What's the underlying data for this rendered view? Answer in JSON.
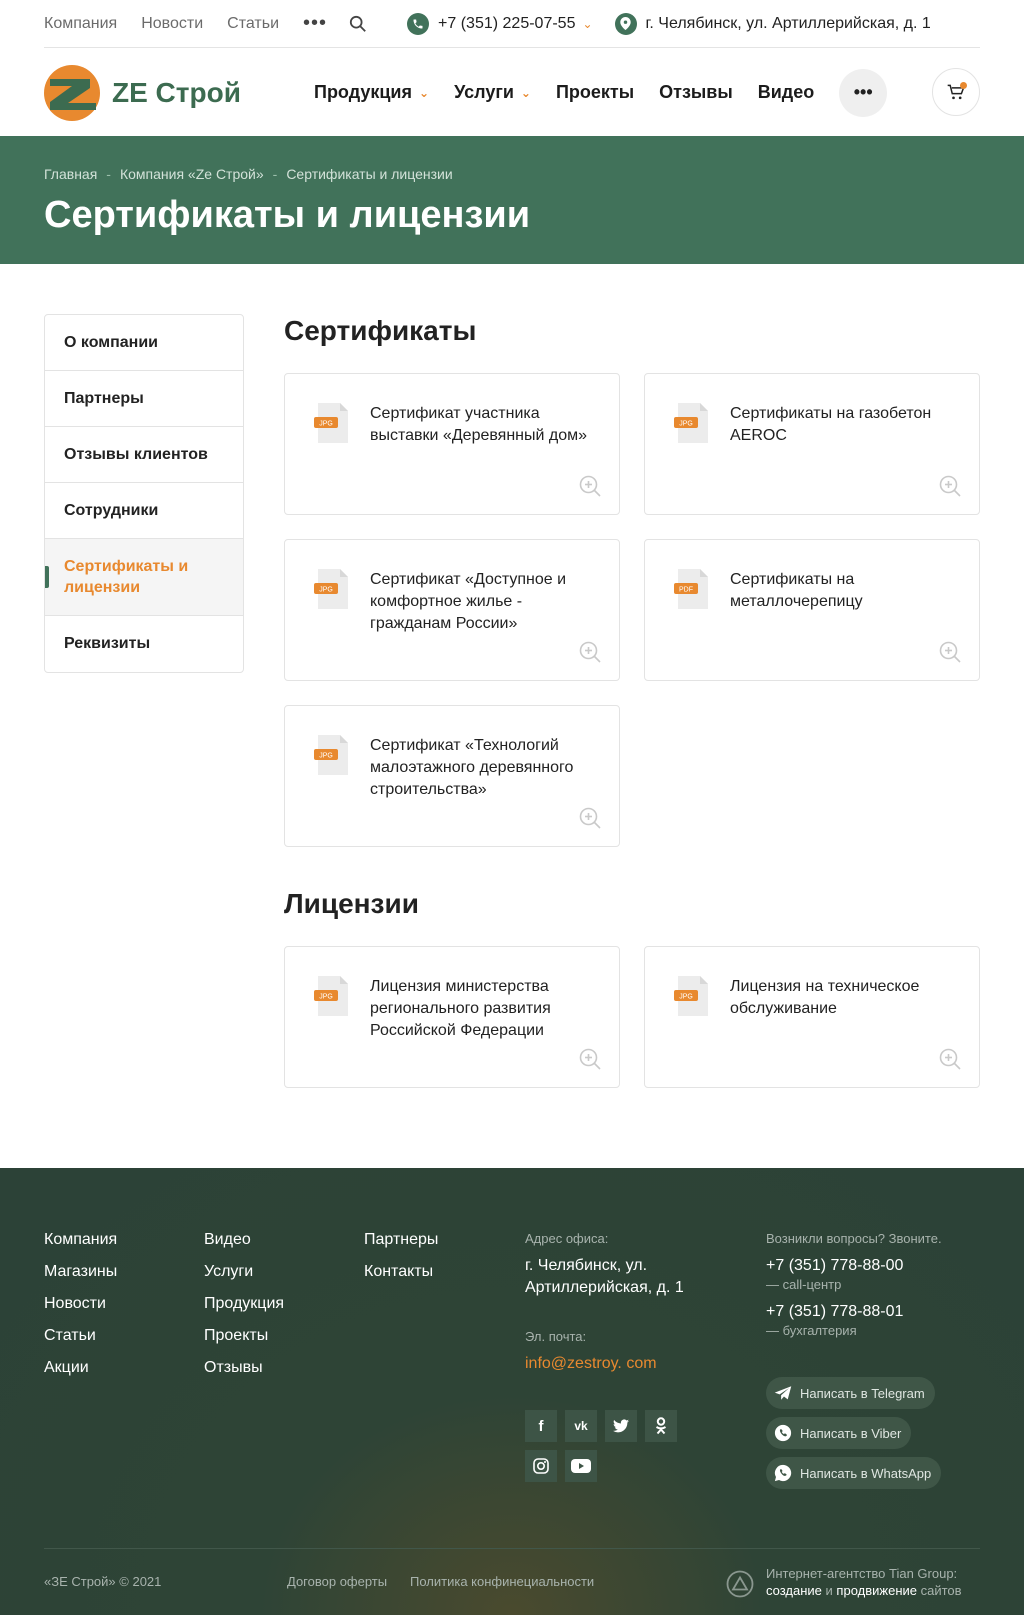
{
  "topbar": {
    "links": [
      "Компания",
      "Новости",
      "Статьи"
    ],
    "more": "•••",
    "phone": "+7 (351) 225-07-55",
    "address": "г. Челябинск, ул. Артиллерийская, д. 1"
  },
  "header": {
    "logo_text": "ZE Строй",
    "nav": [
      "Продукция",
      "Услуги",
      "Проекты",
      "Отзывы",
      "Видео"
    ],
    "more": "•••"
  },
  "breadcrumbs": [
    "Главная",
    "Компания «Ze Строй»",
    "Сертификаты и лицензии"
  ],
  "breadcrumb_sep": "-",
  "page_title": "Сертификаты и лицензии",
  "sidebar": [
    "О компании",
    "Партнеры",
    "Отзывы клиентов",
    "Сотрудники",
    "Сертификаты и лицензии",
    "Реквизиты"
  ],
  "certificates": {
    "title": "Сертификаты",
    "items": [
      {
        "title": "Сертификат участника выставки «Деревянный дом»",
        "type": "JPG"
      },
      {
        "title": "Сертификаты на газобетон AEROC",
        "type": "JPG"
      },
      {
        "title": "Сертификат «Доступное и комфортное жилье - гражданам России»",
        "type": "JPG"
      },
      {
        "title": "Сертификаты на металлочерепицу",
        "type": "PDF"
      },
      {
        "title": "Сертификат «Технологий малоэтажного деревянного строительства»",
        "type": "JPG"
      }
    ]
  },
  "licenses": {
    "title": "Лицензии",
    "items": [
      {
        "title": "Лицензия министерства регионального развития Российской Федерации",
        "type": "JPG"
      },
      {
        "title": "Лицензия на техническое обслуживание",
        "type": "JPG"
      }
    ]
  },
  "footer": {
    "col1": [
      "Компания",
      "Магазины",
      "Новости",
      "Статьи",
      "Акции"
    ],
    "col2": [
      "Видео",
      "Услуги",
      "Продукция",
      "Проекты",
      "Отзывы"
    ],
    "col3": [
      "Партнеры",
      "Контакты"
    ],
    "address_label": "Адрес офиса:",
    "address_line1": "г. Челябинск, ул.",
    "address_line2": "Артиллерийская, д. 1",
    "email_label": "Эл. почта:",
    "email": "info@zestroy. com",
    "questions_label": "Возникли вопросы? Звоните.",
    "phone1": "+7 (351) 778-88-00",
    "phone1_note": "— call-центр",
    "phone2": "+7 (351) 778-88-01",
    "phone2_note": "— бухгалтерия",
    "telegram": "Написать в Telegram",
    "viber": "Написать в Viber",
    "whatsapp": "Написать в WhatsApp",
    "social": [
      "f",
      "vk",
      "twitter",
      "ok",
      "instagram",
      "youtube"
    ],
    "copyright": "«ЗЕ Строй» © 2021",
    "offer": "Договор оферты",
    "privacy": "Политика конфинециальности",
    "agency_line1": "Интернет-агентство Tian Group:",
    "agency_create": "создание",
    "agency_and": "и",
    "agency_promote": "продвижение",
    "agency_sites": "сайтов"
  },
  "colors": {
    "brand_green": "#41725a",
    "accent_orange": "#e8892f",
    "footer_bg": "#2c4237"
  }
}
